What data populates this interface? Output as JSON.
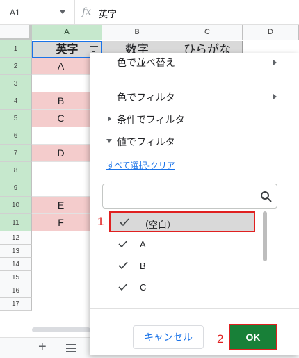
{
  "formula_bar": {
    "cell_ref": "A1",
    "fx_label": "fx",
    "value": "英字"
  },
  "columns": [
    "A",
    "B",
    "C",
    "D"
  ],
  "rows": [
    {
      "num": "1",
      "a": "英字",
      "b": "数字",
      "c": "ひらがな"
    },
    {
      "num": "2",
      "a": "A"
    },
    {
      "num": "3",
      "a": ""
    },
    {
      "num": "4",
      "a": "B"
    },
    {
      "num": "5",
      "a": "C"
    },
    {
      "num": "6",
      "a": ""
    },
    {
      "num": "7",
      "a": "D"
    },
    {
      "num": "8",
      "a": ""
    },
    {
      "num": "9",
      "a": ""
    },
    {
      "num": "10",
      "a": "E"
    },
    {
      "num": "11",
      "a": "F"
    },
    {
      "num": "12"
    },
    {
      "num": "13"
    },
    {
      "num": "14"
    },
    {
      "num": "15"
    },
    {
      "num": "16"
    },
    {
      "num": "17"
    }
  ],
  "filter_menu": {
    "sort_by_color": "色で並べ替え",
    "filter_by_color": "色でフィルタ",
    "filter_by_condition": "条件でフィルタ",
    "filter_by_values": "値でフィルタ",
    "select_all": "すべて選択",
    "separator": "-",
    "clear": "クリア",
    "search_placeholder": "",
    "values": [
      {
        "label": "（空白）",
        "checked": true
      },
      {
        "label": "A",
        "checked": true
      },
      {
        "label": "B",
        "checked": true
      },
      {
        "label": "C",
        "checked": true
      }
    ],
    "cancel_label": "キャンセル",
    "ok_label": "OK"
  },
  "annotations": {
    "step1": "1",
    "step2": "2"
  },
  "bottom_bar": {
    "add_sheet": "+"
  },
  "colors": {
    "pink_fill": "#f4cccc",
    "header_fill": "#d9d9d9",
    "ok_green": "#188038",
    "annotation_red": "#e02020",
    "selection_blue": "#1a73e8"
  }
}
